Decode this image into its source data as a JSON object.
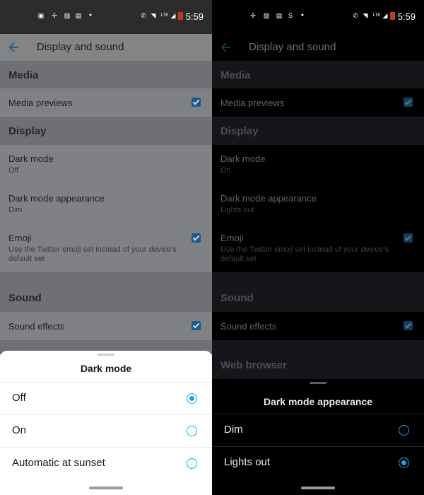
{
  "status_bar": {
    "time": "5:59",
    "signal_label": "LTE"
  },
  "app_bar": {
    "title": "Display and sound"
  },
  "sections": {
    "media": "Media",
    "display": "Display",
    "sound": "Sound",
    "web_browser": "Web browser"
  },
  "rows": {
    "media_previews": "Media previews",
    "dark_mode": "Dark mode",
    "dark_mode_appearance": "Dark mode appearance",
    "emoji": "Emoji",
    "emoji_sub": "Use the Twitter emoji set instead of your device's default set",
    "sound_effects": "Sound effects"
  },
  "left": {
    "dark_mode_value": "Off",
    "appearance_value": "Dim",
    "sheet": {
      "title": "Dark mode",
      "options": [
        {
          "label": "Off",
          "selected": true
        },
        {
          "label": "On",
          "selected": false
        },
        {
          "label": "Automatic at sunset",
          "selected": false
        }
      ]
    }
  },
  "right": {
    "dark_mode_value": "On",
    "appearance_value": "Lights out",
    "sheet": {
      "title": "Dark mode appearance",
      "options": [
        {
          "label": "Dim",
          "selected": false
        },
        {
          "label": "Lights out",
          "selected": true
        }
      ]
    }
  },
  "colors": {
    "accent": "#1da1f2",
    "checkbox": "#1a5a8a"
  },
  "icons": [
    "back-arrow-icon",
    "checkbox-checked-icon",
    "radio-selected-icon",
    "radio-unselected-icon",
    "wifi-icon",
    "signal-icon",
    "battery-icon"
  ]
}
